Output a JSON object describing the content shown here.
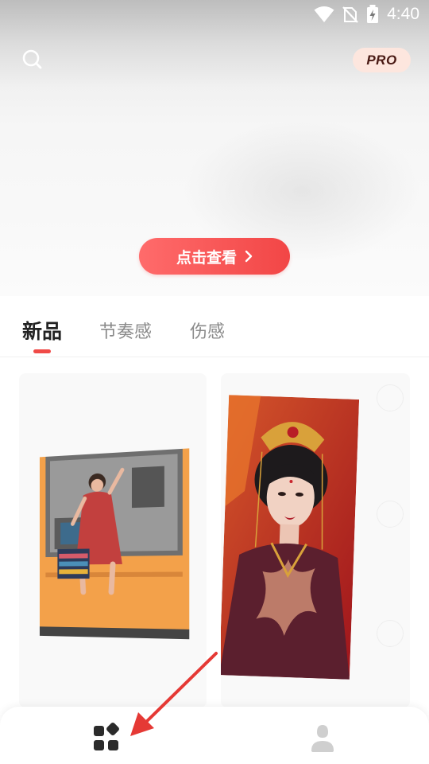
{
  "status_bar": {
    "time": "4:40",
    "icons": [
      "wifi-icon",
      "no-sim-icon",
      "battery-charging-icon"
    ]
  },
  "header": {
    "search_icon": "search-icon",
    "pro_badge": "PRO"
  },
  "banner": {
    "cta_label": "点击查看",
    "cta_icon": "chevron-right-icon"
  },
  "tabs": [
    {
      "label": "新品",
      "active": true
    },
    {
      "label": "节奏感",
      "active": false
    },
    {
      "label": "伤感",
      "active": false
    }
  ],
  "templates": [
    {
      "thumbnail": "woman-in-red-dress-sitting-on-orange-bench-photo"
    },
    {
      "thumbnail": "woman-in-traditional-chinese-bridal-headdress-photo"
    }
  ],
  "bottom_nav": [
    {
      "icon": "grid-apps-icon",
      "active": true
    },
    {
      "icon": "person-icon",
      "active": false
    }
  ],
  "annotation": {
    "icon": "red-arrow-pointer-icon",
    "color": "#e53935"
  },
  "colors": {
    "accent": "#f04a47",
    "cta_gradient_start": "#ff6b6b",
    "cta_gradient_end": "#f24646",
    "pro_badge_bg": "#fde6de",
    "tab_active": "#222222",
    "tab_inactive": "#8a8a8a"
  }
}
